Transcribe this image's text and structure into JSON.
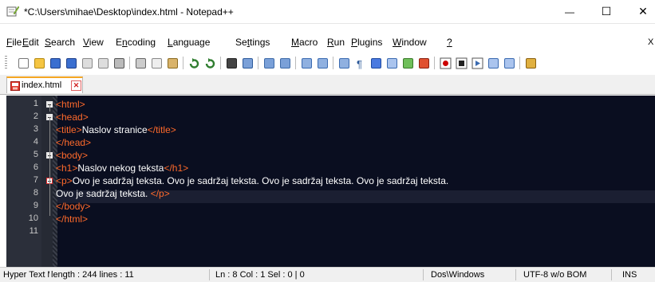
{
  "window": {
    "title": "*C:\\Users\\mihae\\Desktop\\index.html - Notepad++",
    "minimize_glyph": "—",
    "maximize_glyph": "☐",
    "close_glyph": "✕"
  },
  "menu": {
    "items": [
      {
        "pre": "",
        "ul": "F",
        "post": "ile"
      },
      {
        "pre": "",
        "ul": "E",
        "post": "dit"
      },
      {
        "pre": "",
        "ul": "S",
        "post": "earch"
      },
      {
        "pre": "",
        "ul": "V",
        "post": "iew"
      },
      {
        "pre": "E",
        "ul": "n",
        "post": "coding"
      },
      {
        "pre": "",
        "ul": "L",
        "post": "anguage"
      },
      {
        "pre": "Se",
        "ul": "t",
        "post": "tings"
      },
      {
        "pre": "",
        "ul": "M",
        "post": "acro"
      },
      {
        "pre": "",
        "ul": "R",
        "post": "un"
      },
      {
        "pre": "",
        "ul": "P",
        "post": "lugins"
      },
      {
        "pre": "",
        "ul": "W",
        "post": "indow"
      },
      {
        "pre": "",
        "ul": "?",
        "post": ""
      }
    ],
    "close_doc_glyph": "X"
  },
  "tab": {
    "label": "index.html",
    "close_glyph": "✕"
  },
  "editor": {
    "lines": [
      {
        "num": "1",
        "fold": true,
        "parts": [
          {
            "c": "tag",
            "t": "<html>"
          }
        ]
      },
      {
        "num": "2",
        "fold": true,
        "parts": [
          {
            "c": "tag",
            "t": "<head>"
          }
        ]
      },
      {
        "num": "3",
        "fold": false,
        "parts": [
          {
            "c": "tag",
            "t": "<title>"
          },
          {
            "c": "txt",
            "t": "Naslov stranice"
          },
          {
            "c": "tag",
            "t": "</title>"
          }
        ]
      },
      {
        "num": "4",
        "fold": false,
        "parts": [
          {
            "c": "tag",
            "t": "</head>"
          }
        ]
      },
      {
        "num": "5",
        "fold": true,
        "parts": [
          {
            "c": "tag",
            "t": "<body>"
          }
        ]
      },
      {
        "num": "6",
        "fold": false,
        "parts": [
          {
            "c": "tag",
            "t": "<h1>"
          },
          {
            "c": "txt",
            "t": "Naslov nekog teksta"
          },
          {
            "c": "tag",
            "t": "</h1>"
          }
        ]
      },
      {
        "num": "7",
        "fold": true,
        "parts": [
          {
            "c": "tag",
            "t": "<p>"
          },
          {
            "c": "txt",
            "t": "Ovo je sadržaj teksta. Ovo je sadržaj teksta. Ovo je sadržaj teksta. Ovo je sadržaj teksta."
          }
        ]
      },
      {
        "num": "8",
        "fold": false,
        "parts": [
          {
            "c": "txt",
            "t": "Ovo je sadržaj teksta. "
          },
          {
            "c": "tag",
            "t": "</p>"
          }
        ]
      },
      {
        "num": "9",
        "fold": false,
        "parts": [
          {
            "c": "tag",
            "t": "</body>"
          }
        ]
      },
      {
        "num": "10",
        "fold": false,
        "parts": [
          {
            "c": "tag",
            "t": "</html>"
          }
        ]
      },
      {
        "num": "11",
        "fold": false,
        "parts": []
      }
    ]
  },
  "status": {
    "file_type": "Hyper Text Markup Language file",
    "length": "length : 244    lines : 11",
    "position": "Ln : 8    Col : 1    Sel : 0 | 0",
    "eol": "Dos\\Windows",
    "encoding": "UTF-8 w/o BOM",
    "mode": "INS"
  },
  "colors": {
    "editor_bg": "#0a0e20",
    "tag": "#ff6a2b",
    "text": "#ffffff",
    "tab_accent": "#f5a623"
  }
}
